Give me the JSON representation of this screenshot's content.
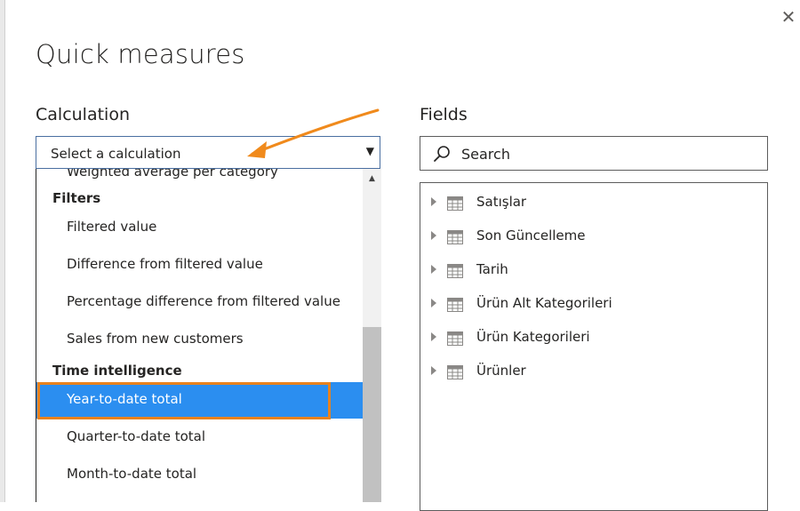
{
  "dialog": {
    "title": "Quick measures",
    "close_glyph": "✕"
  },
  "calculation": {
    "label": "Calculation",
    "select_value": "Select a calculation",
    "caret_glyph": "▼",
    "partial_item": "Weighted average per category",
    "groups": [
      {
        "header": "Filters",
        "items": [
          "Filtered value",
          "Difference from filtered value",
          "Percentage difference from filtered value",
          "Sales from new customers"
        ]
      },
      {
        "header": "Time intelligence",
        "items": [
          "Year-to-date total",
          "Quarter-to-date total",
          "Month-to-date total"
        ]
      }
    ],
    "selected_item": "Year-to-date total",
    "scroll_up_glyph": "▲"
  },
  "fields": {
    "label": "Fields",
    "search_placeholder": "Search",
    "tables": [
      "Satışlar",
      "Son Güncelleme",
      "Tarih",
      "Ürün Alt Kategorileri",
      "Ürün Kategorileri",
      "Ürünler"
    ]
  },
  "colors": {
    "selection_blue": "#2b8ef0",
    "annotation_orange": "#e8821e"
  },
  "icons": {
    "close": "close-icon",
    "dropdown": "chevron-down-icon",
    "search": "search-icon",
    "table": "table-icon",
    "expand": "expand-caret-icon",
    "annotation": "arrow-annotation-icon"
  }
}
